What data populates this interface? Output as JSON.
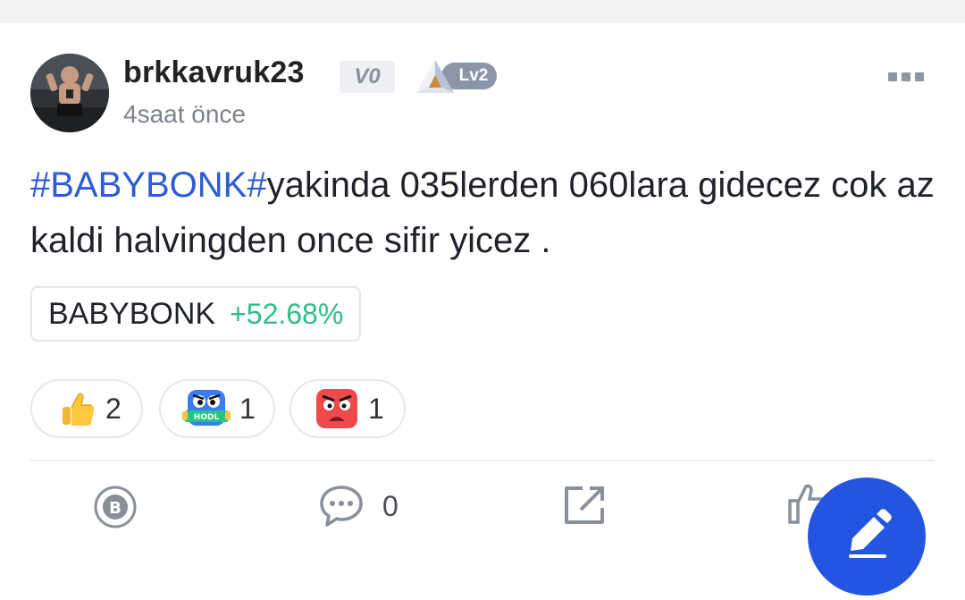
{
  "post": {
    "username": "brkkavruk23",
    "vip_label": "V0",
    "level_label": "Lv2",
    "timestamp": "4saat önce",
    "hashtag": "#BABYBONK#",
    "text_rest": "yakinda 035lerden 060lara gidecez cok az kaldi halvingden once sifir yicez ."
  },
  "coin_tag": {
    "name": "BABYBONK",
    "change": "+52.68%",
    "change_color": "#2ebd85"
  },
  "reactions": [
    {
      "icon": "thumbs-up-emoji-icon",
      "count": "2"
    },
    {
      "icon": "hodl-emoji-icon",
      "count": "1"
    },
    {
      "icon": "angry-face-emoji-icon",
      "count": "1"
    }
  ],
  "actions": {
    "tip_icon": "coin-b-icon",
    "comment_icon": "comment-bubble-icon",
    "comment_count": "0",
    "share_icon": "share-icon",
    "like_icon": "thumbs-up-outline-icon",
    "fab_icon": "pencil-icon"
  },
  "colors": {
    "hashtag": "#2f5bd3",
    "fab": "#2455e0",
    "positive": "#2ebd85"
  }
}
